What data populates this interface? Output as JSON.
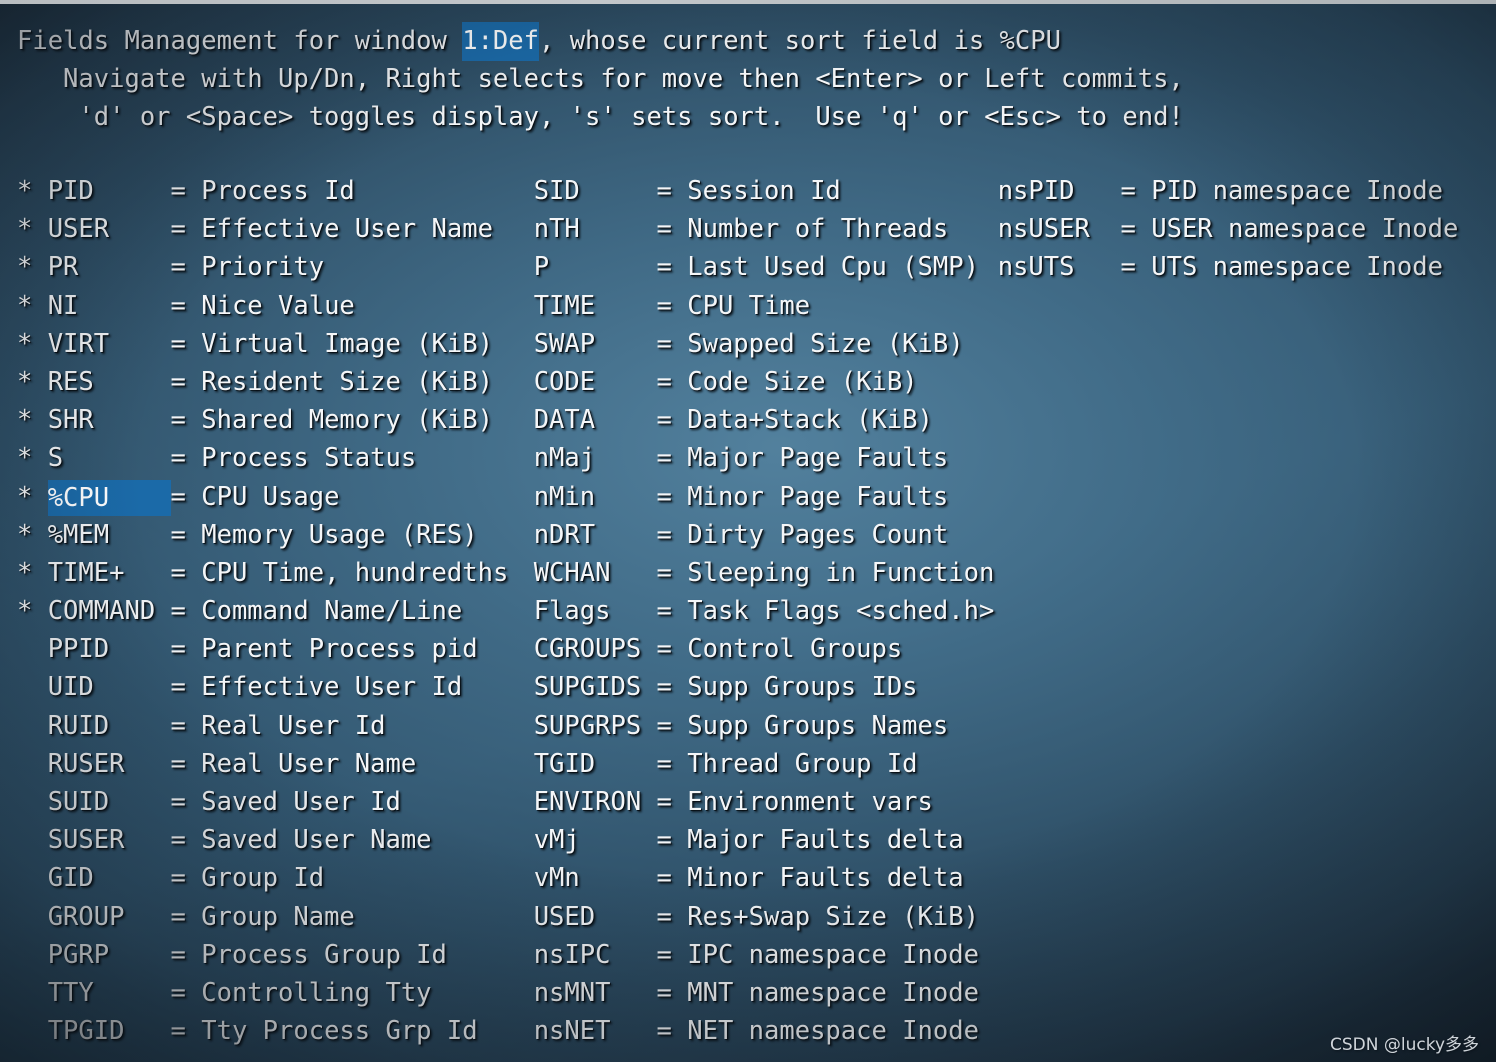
{
  "window": {
    "title": "Fields Management for window 1:Def, whose current sort field is %CPU",
    "top_strip_color": "#bcc0c3",
    "background_color": "#31556e",
    "text_color": "#f4f6f8",
    "highlight_color": "#1b6aa8"
  },
  "header": {
    "line1_before": "Fields Management for window ",
    "line1_window": "1:Def",
    "line1_after": ", whose current sort field is %CPU",
    "line2": "   Navigate with Up/Dn, Right selects for move then <Enter> or Left commits,",
    "line3": "    'd' or <Space> toggles display, 's' sets sort.  Use 'q' or <Esc> to end!"
  },
  "legend": {
    "selected_field": "%CPU",
    "sort_field": "%CPU",
    "window_name": "1:Def",
    "displayed_marker": "*",
    "hidden_marker": " "
  },
  "columns": [
    {
      "id": "column-1",
      "rows": [
        {
          "mark": "*",
          "name": "PID",
          "eq": "=",
          "desc": "Process Id",
          "selected": false
        },
        {
          "mark": "*",
          "name": "USER",
          "eq": "=",
          "desc": "Effective User Name",
          "selected": false
        },
        {
          "mark": "*",
          "name": "PR",
          "eq": "=",
          "desc": "Priority",
          "selected": false
        },
        {
          "mark": "*",
          "name": "NI",
          "eq": "=",
          "desc": "Nice Value",
          "selected": false
        },
        {
          "mark": "*",
          "name": "VIRT",
          "eq": "=",
          "desc": "Virtual Image (KiB)",
          "selected": false
        },
        {
          "mark": "*",
          "name": "RES",
          "eq": "=",
          "desc": "Resident Size (KiB)",
          "selected": false
        },
        {
          "mark": "*",
          "name": "SHR",
          "eq": "=",
          "desc": "Shared Memory (KiB)",
          "selected": false
        },
        {
          "mark": "*",
          "name": "S",
          "eq": "=",
          "desc": "Process Status",
          "selected": false
        },
        {
          "mark": "*",
          "name": "%CPU",
          "eq": "=",
          "desc": "CPU Usage",
          "selected": true
        },
        {
          "mark": "*",
          "name": "%MEM",
          "eq": "=",
          "desc": "Memory Usage (RES)",
          "selected": false
        },
        {
          "mark": "*",
          "name": "TIME+",
          "eq": "=",
          "desc": "CPU Time, hundredths",
          "selected": false
        },
        {
          "mark": "*",
          "name": "COMMAND",
          "eq": "=",
          "desc": "Command Name/Line",
          "selected": false
        },
        {
          "mark": " ",
          "name": "PPID",
          "eq": "=",
          "desc": "Parent Process pid",
          "selected": false
        },
        {
          "mark": " ",
          "name": "UID",
          "eq": "=",
          "desc": "Effective User Id",
          "selected": false
        },
        {
          "mark": " ",
          "name": "RUID",
          "eq": "=",
          "desc": "Real User Id",
          "selected": false
        },
        {
          "mark": " ",
          "name": "RUSER",
          "eq": "=",
          "desc": "Real User Name",
          "selected": false
        },
        {
          "mark": " ",
          "name": "SUID",
          "eq": "=",
          "desc": "Saved User Id",
          "selected": false
        },
        {
          "mark": " ",
          "name": "SUSER",
          "eq": "=",
          "desc": "Saved User Name",
          "selected": false
        },
        {
          "mark": " ",
          "name": "GID",
          "eq": "=",
          "desc": "Group Id",
          "selected": false
        },
        {
          "mark": " ",
          "name": "GROUP",
          "eq": "=",
          "desc": "Group Name",
          "selected": false
        },
        {
          "mark": " ",
          "name": "PGRP",
          "eq": "=",
          "desc": "Process Group Id",
          "selected": false
        },
        {
          "mark": " ",
          "name": "TTY",
          "eq": "=",
          "desc": "Controlling Tty",
          "selected": false
        },
        {
          "mark": " ",
          "name": "TPGID",
          "eq": "=",
          "desc": "Tty Process Grp Id",
          "selected": false
        }
      ]
    },
    {
      "id": "column-2",
      "rows": [
        {
          "mark": " ",
          "name": "SID",
          "eq": "=",
          "desc": "Session Id",
          "selected": false
        },
        {
          "mark": " ",
          "name": "nTH",
          "eq": "=",
          "desc": "Number of Threads",
          "selected": false
        },
        {
          "mark": " ",
          "name": "P",
          "eq": "=",
          "desc": "Last Used Cpu (SMP)",
          "selected": false
        },
        {
          "mark": " ",
          "name": "TIME",
          "eq": "=",
          "desc": "CPU Time",
          "selected": false
        },
        {
          "mark": " ",
          "name": "SWAP",
          "eq": "=",
          "desc": "Swapped Size (KiB)",
          "selected": false
        },
        {
          "mark": " ",
          "name": "CODE",
          "eq": "=",
          "desc": "Code Size (KiB)",
          "selected": false
        },
        {
          "mark": " ",
          "name": "DATA",
          "eq": "=",
          "desc": "Data+Stack (KiB)",
          "selected": false
        },
        {
          "mark": " ",
          "name": "nMaj",
          "eq": "=",
          "desc": "Major Page Faults",
          "selected": false
        },
        {
          "mark": " ",
          "name": "nMin",
          "eq": "=",
          "desc": "Minor Page Faults",
          "selected": false
        },
        {
          "mark": " ",
          "name": "nDRT",
          "eq": "=",
          "desc": "Dirty Pages Count",
          "selected": false
        },
        {
          "mark": " ",
          "name": "WCHAN",
          "eq": "=",
          "desc": "Sleeping in Function",
          "selected": false
        },
        {
          "mark": " ",
          "name": "Flags",
          "eq": "=",
          "desc": "Task Flags <sched.h>",
          "selected": false
        },
        {
          "mark": " ",
          "name": "CGROUPS",
          "eq": "=",
          "desc": "Control Groups",
          "selected": false
        },
        {
          "mark": " ",
          "name": "SUPGIDS",
          "eq": "=",
          "desc": "Supp Groups IDs",
          "selected": false
        },
        {
          "mark": " ",
          "name": "SUPGRPS",
          "eq": "=",
          "desc": "Supp Groups Names",
          "selected": false
        },
        {
          "mark": " ",
          "name": "TGID",
          "eq": "=",
          "desc": "Thread Group Id",
          "selected": false
        },
        {
          "mark": " ",
          "name": "ENVIRON",
          "eq": "=",
          "desc": "Environment vars",
          "selected": false
        },
        {
          "mark": " ",
          "name": "vMj",
          "eq": "=",
          "desc": "Major Faults delta",
          "selected": false
        },
        {
          "mark": " ",
          "name": "vMn",
          "eq": "=",
          "desc": "Minor Faults delta",
          "selected": false
        },
        {
          "mark": " ",
          "name": "USED",
          "eq": "=",
          "desc": "Res+Swap Size (KiB)",
          "selected": false
        },
        {
          "mark": " ",
          "name": "nsIPC",
          "eq": "=",
          "desc": "IPC namespace Inode",
          "selected": false
        },
        {
          "mark": " ",
          "name": "nsMNT",
          "eq": "=",
          "desc": "MNT namespace Inode",
          "selected": false
        },
        {
          "mark": " ",
          "name": "nsNET",
          "eq": "=",
          "desc": "NET namespace Inode",
          "selected": false
        }
      ]
    },
    {
      "id": "column-3",
      "rows": [
        {
          "mark": " ",
          "name": "nsPID",
          "eq": "=",
          "desc": "PID namespace Inode",
          "selected": false
        },
        {
          "mark": " ",
          "name": "nsUSER",
          "eq": "=",
          "desc": "USER namespace Inode",
          "selected": false
        },
        {
          "mark": " ",
          "name": "nsUTS",
          "eq": "=",
          "desc": "UTS namespace Inode",
          "selected": false
        }
      ]
    }
  ],
  "watermark": "CSDN @lucky多多"
}
